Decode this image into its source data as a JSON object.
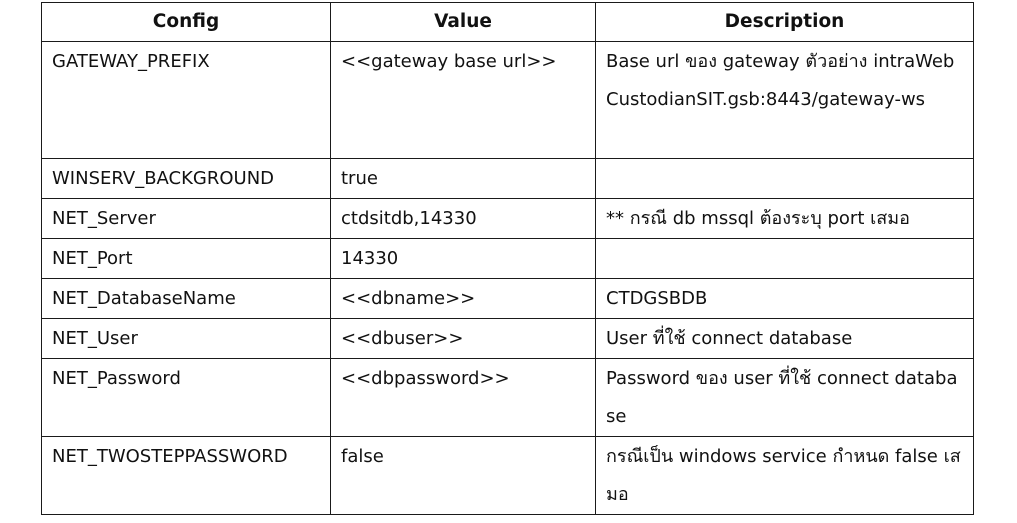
{
  "table": {
    "headers": [
      "Config",
      "Value",
      "Description"
    ],
    "rows": [
      {
        "config": "GATEWAY_PREFIX",
        "value": "<<gateway base url>>",
        "description": "Base url ของ gateway ตัวอย่าง intraWebCustodianSIT.gsb:8443/gateway-ws"
      },
      {
        "config": "WINSERV_BACKGROUND",
        "value": "true",
        "description": ""
      },
      {
        "config": "NET_Server",
        "value": "ctdsitdb,14330",
        "description": "** กรณี db mssql ต้องระบุ port เสมอ"
      },
      {
        "config": "NET_Port",
        "value": "14330",
        "description": ""
      },
      {
        "config": "NET_DatabaseName",
        "value": "<<dbname>>",
        "description": "CTDGSBDB"
      },
      {
        "config": "NET_User",
        "value": "<<dbuser>>",
        "description": "User ที่ใช้ connect database"
      },
      {
        "config": "NET_Password",
        "value": "<<dbpassword>>",
        "description": "Password ของ user ที่ใช้ connect database"
      },
      {
        "config": "NET_TWOSTEPPASSWORD",
        "value": "false",
        "description": "กรณีเป็น windows service กำหนด false เสมอ"
      }
    ]
  }
}
